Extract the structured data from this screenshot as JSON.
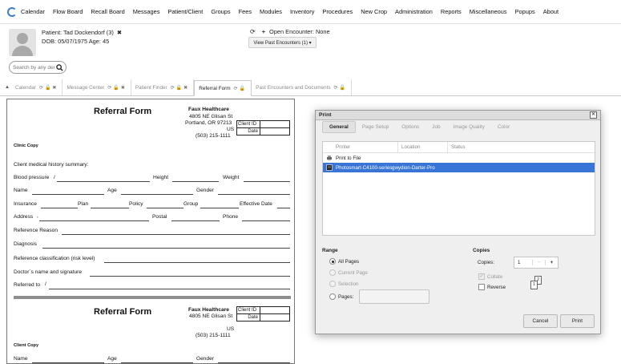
{
  "menu": {
    "items": [
      "Calendar",
      "Flow Board",
      "Recall Board",
      "Messages",
      "Patient/Client",
      "Groups",
      "Fees",
      "Modules",
      "Inventory",
      "Procedures",
      "New Crop",
      "Administration",
      "Reports",
      "Miscellaneous",
      "Popups",
      "About"
    ]
  },
  "patient": {
    "name": "Patient: Tad Dockendorf (3)",
    "close": "✖",
    "dob": "DOB: 05/07/1975 Age: 45",
    "search_placeholder": "Search by any demographics"
  },
  "encounter": {
    "open_text": "Open Encounter: None",
    "view_past": "View Past Encounters  (1) ▾"
  },
  "tabs": [
    {
      "label": "Calendar",
      "active": false
    },
    {
      "label": "Message Center",
      "active": false
    },
    {
      "label": "Patient Finder",
      "active": false
    },
    {
      "label": "Referral Form",
      "active": true
    },
    {
      "label": "Past Encounters and Documents",
      "active": false
    }
  ],
  "form": {
    "title": "Referral Form",
    "clinic_name": "Faux Healthcare",
    "address1": "4805 NE Glisan St",
    "address2": "Portland, OR 97213",
    "country": "US",
    "phone": "(503) 215-1111",
    "client_id_label": "Client ID",
    "date_label": "Date",
    "copy_label_1": "Clinic Copy",
    "copy_label_2": "Client Copy",
    "summary_label": "Client medical history summary:",
    "blood_pressure": "Blood pressure",
    "bp_separator": "/",
    "height": "Height",
    "weight": "Weight",
    "name": "Name",
    "age": "Age",
    "gender": "Gender",
    "insurance": "Insurance",
    "plan": "Plan",
    "policy": "Policy",
    "group": "Group",
    "effective_date": "Effective Date",
    "address": "Address",
    "address_mark": ",",
    "postal": "Postal",
    "phone_label": "Phone",
    "reference_reason": "Reference Reason",
    "diagnosis": "Diagnosis",
    "reference_classification": "Reference classification (risk level)",
    "doctor_signature": "Doctor´s name and signature",
    "referred_to": "Referred to",
    "referred_separator": "/"
  },
  "print_dialog": {
    "title": "Print",
    "close": "✕",
    "tabs": [
      "General",
      "Page Setup",
      "Options",
      "Job",
      "Image Quality",
      "Color"
    ],
    "columns": [
      "Printer",
      "Location",
      "Status"
    ],
    "printers": [
      {
        "name": "Print to File",
        "location": "",
        "status": "",
        "selected": false
      },
      {
        "name": "Photosmart-C4100-series",
        "location": "gwydion-Darter-Pro",
        "status": "",
        "selected": true
      }
    ],
    "range_title": "Range",
    "range_options": [
      {
        "label": "All Pages",
        "selected": true,
        "enabled": true
      },
      {
        "label": "Current Page",
        "selected": false,
        "enabled": false
      },
      {
        "label": "Selection",
        "selected": false,
        "enabled": false
      },
      {
        "label": "Pages:",
        "selected": false,
        "enabled": true
      }
    ],
    "copies_title": "Copies",
    "copies_label": "Copies:",
    "copies_value": "1",
    "minus": "−",
    "plus": "+",
    "collate_label": "Collate",
    "reverse_label": "Reverse",
    "collate_pages": [
      "1",
      "2"
    ],
    "cancel_label": "Cancel",
    "print_label": "Print"
  }
}
